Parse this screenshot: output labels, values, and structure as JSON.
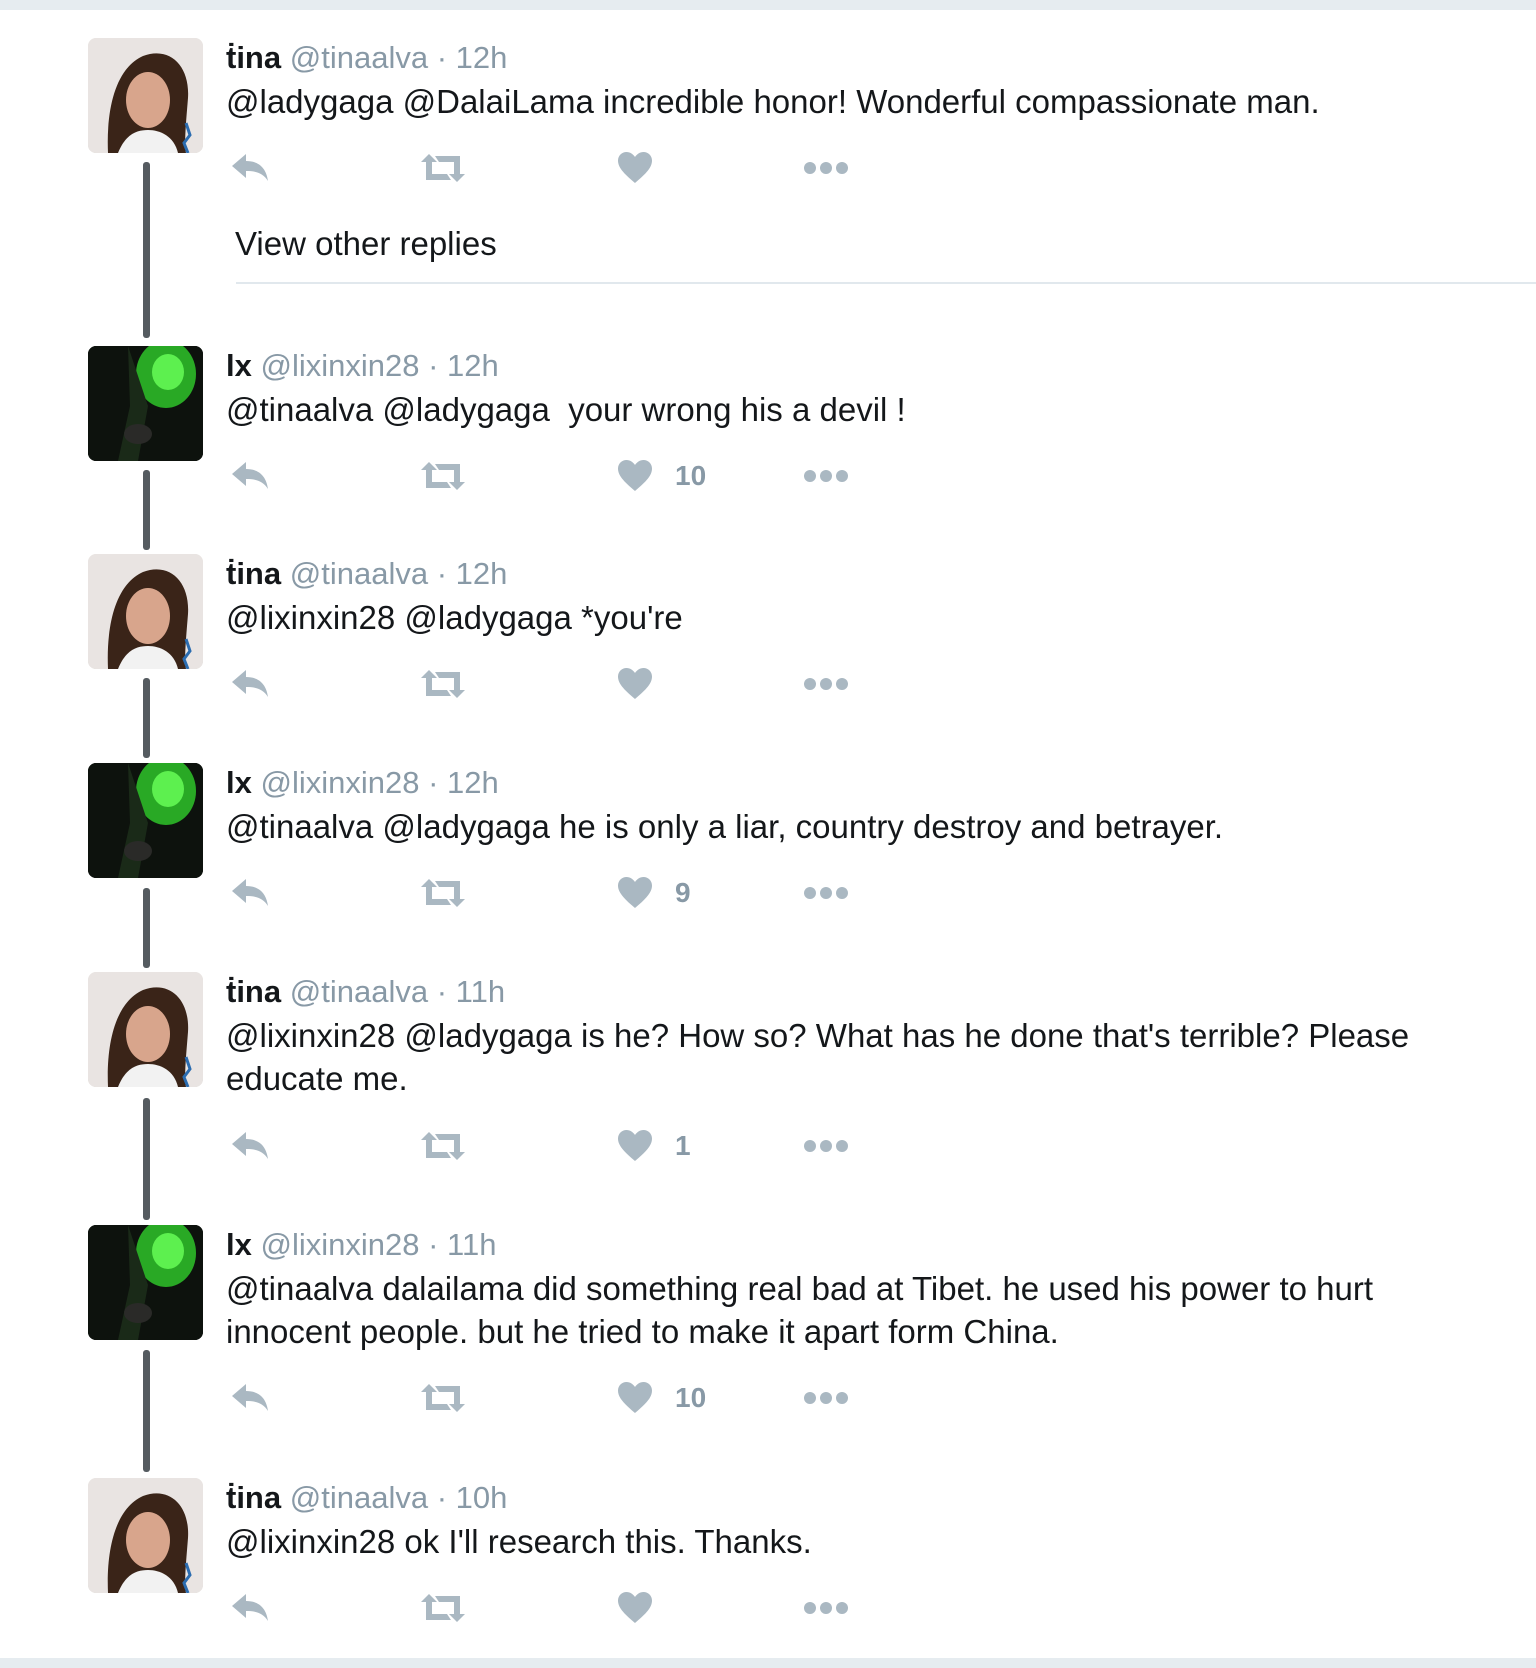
{
  "thread": {
    "view_other_replies": "View other replies",
    "tweets": [
      {
        "author": "tina",
        "name": "ṫina",
        "handle": "@tinaalva",
        "time": "12h",
        "text": "@ladygaga @DalaiLama incredible honor! Wonderful compassionate man.",
        "likes": ""
      },
      {
        "author": "lx",
        "name": "lx",
        "handle": "@lixinxin28",
        "time": "12h",
        "text": "@tinaalva @ladygaga  your wrong his a devil !",
        "likes": "10"
      },
      {
        "author": "tina",
        "name": "ṫina",
        "handle": "@tinaalva",
        "time": "12h",
        "text": "@lixinxin28 @ladygaga *you're",
        "likes": ""
      },
      {
        "author": "lx",
        "name": "lx",
        "handle": "@lixinxin28",
        "time": "12h",
        "text": "@tinaalva @ladygaga he is only a liar, country destroy and betrayer.",
        "likes": "9"
      },
      {
        "author": "tina",
        "name": "ṫina",
        "handle": "@tinaalva",
        "time": "11h",
        "text": "@lixinxin28 @ladygaga is he? How so? What has he done that's terrible? Please educate me.",
        "likes": "1"
      },
      {
        "author": "lx",
        "name": "lx",
        "handle": "@lixinxin28",
        "time": "11h",
        "text": "@tinaalva dalailama did something real bad at Tibet. he used his power to hurt innocent people. but he tried to make it apart form China.",
        "likes": "10"
      },
      {
        "author": "tina",
        "name": "ṫina",
        "handle": "@tinaalva",
        "time": "10h",
        "text": "@lixinxin28 ok I'll research this. Thanks.",
        "likes": ""
      }
    ]
  },
  "icons": {
    "reply": "reply-icon",
    "retweet": "retweet-icon",
    "like": "heart-icon",
    "more": "more-dots-icon"
  },
  "colors": {
    "icon_gray": "#aab8c2",
    "handle_gray": "#8899a6",
    "thread_line": "#555b60"
  }
}
